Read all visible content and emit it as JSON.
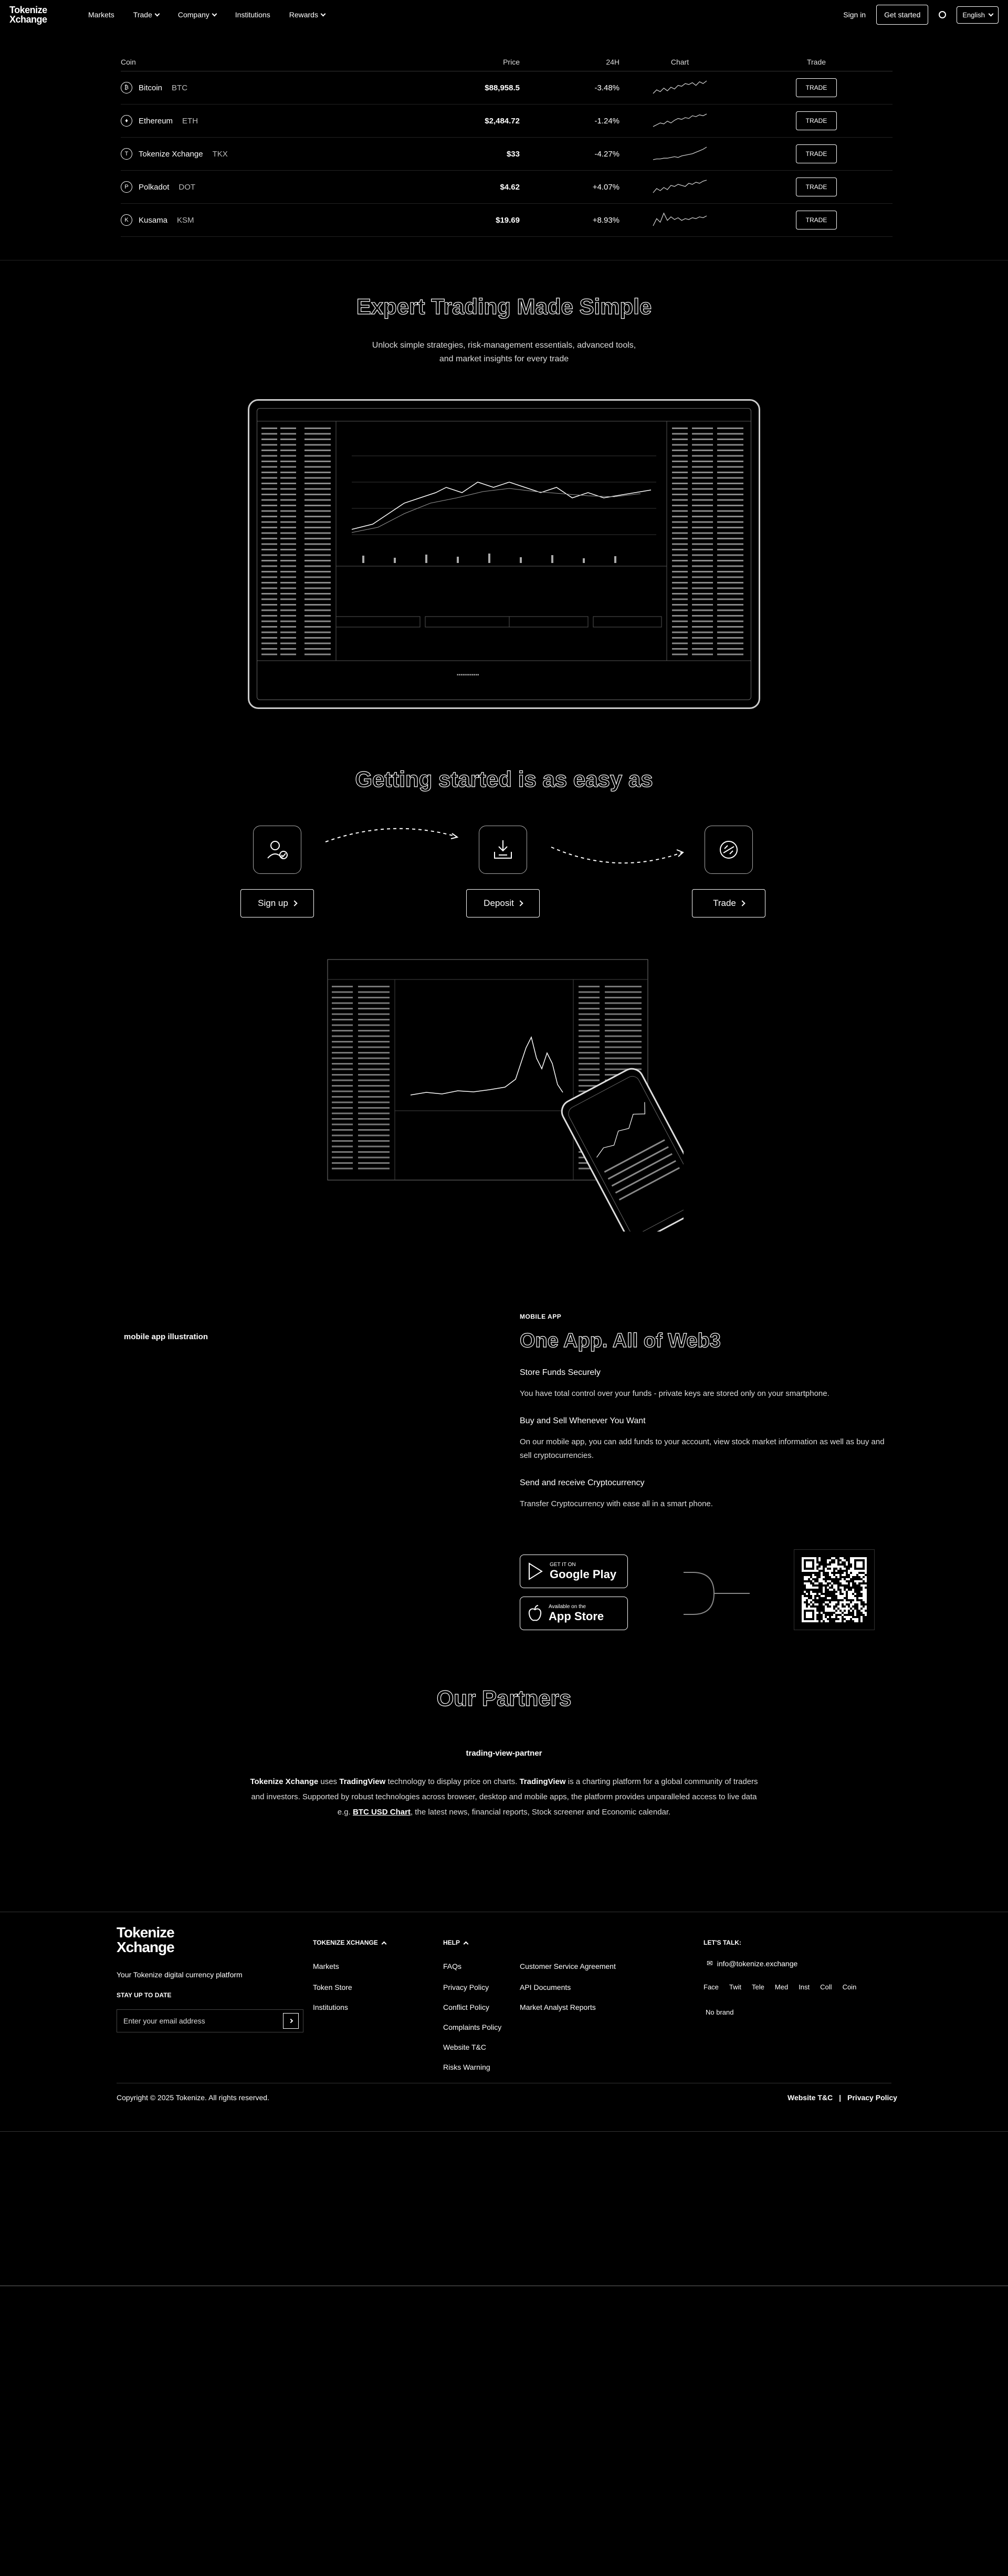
{
  "nav": {
    "logo_line1": "Tokenize",
    "logo_line2": "Xchange",
    "menu": [
      "Markets",
      "Trade",
      "Company",
      "Institutions",
      "Rewards"
    ],
    "sign_in": "Sign in",
    "get_started": "Get started",
    "language": "English"
  },
  "market": {
    "headers": [
      "Coin",
      "Price",
      "24H",
      "Chart",
      "Trade"
    ],
    "rows": [
      {
        "name": "Bitcoin",
        "symbol": "BTC",
        "icon": "₿",
        "price": "$88,958.5",
        "change": "-3.48%",
        "trade": "TRADE",
        "spark": [
          8,
          12,
          10,
          14,
          11,
          15,
          13,
          17,
          16,
          19,
          18,
          20,
          17,
          21,
          19,
          22
        ]
      },
      {
        "name": "Ethereum",
        "symbol": "ETH",
        "icon": "♦",
        "price": "$2,484.72",
        "change": "-1.24%",
        "trade": "TRADE",
        "spark": [
          9,
          11,
          13,
          12,
          15,
          13,
          16,
          18,
          17,
          19,
          18,
          21,
          20,
          22,
          21,
          23
        ]
      },
      {
        "name": "Tokenize Xchange",
        "symbol": "TKX",
        "icon": "T",
        "price": "$33",
        "change": "-4.27%",
        "trade": "TRADE",
        "spark": [
          5,
          6,
          6,
          7,
          7,
          8,
          9,
          8,
          10,
          11,
          12,
          13,
          15,
          17,
          19,
          22
        ]
      },
      {
        "name": "Polkadot",
        "symbol": "DOT",
        "icon": "P",
        "price": "$4.62",
        "change": "+4.07%",
        "trade": "TRADE",
        "spark": [
          10,
          14,
          12,
          15,
          13,
          17,
          16,
          18,
          17,
          16,
          19,
          18,
          20,
          19,
          21,
          22
        ]
      },
      {
        "name": "Kusama",
        "symbol": "KSM",
        "icon": "K",
        "price": "$19.69",
        "change": "+8.93%",
        "trade": "TRADE",
        "spark": [
          8,
          16,
          12,
          22,
          14,
          18,
          15,
          17,
          14,
          16,
          15,
          17,
          16,
          18,
          17,
          19
        ]
      }
    ]
  },
  "expert": {
    "title": "Expert Trading Made Simple",
    "subtitle_1": "Unlock simple strategies, risk-management essentials, advanced tools,",
    "subtitle_2": "and market insights for every trade"
  },
  "getting_started": {
    "title": "Getting started is as easy as",
    "steps": [
      "Sign up",
      "Deposit",
      "Trade"
    ]
  },
  "mobile": {
    "illustration_alt": "mobile app illustration",
    "eyebrow": "MOBILE APP",
    "title": "One App. All of Web3",
    "features": [
      {
        "h": "Store Funds Securely",
        "p": "You have total control over your funds - private keys are stored only on your smartphone."
      },
      {
        "h": "Buy and Sell Whenever You Want",
        "p": "On our mobile app, you can add funds to your account, view stock market information as well as buy and sell cryptocurrencies."
      },
      {
        "h": "Send and receive Cryptocurrency",
        "p": "Transfer Cryptocurrency with ease all in a smart phone."
      }
    ],
    "google_small": "GET IT ON",
    "google_big": "Google Play",
    "apple_small": "Available on the",
    "apple_big": "App Store"
  },
  "partners": {
    "title": "Our Partners",
    "partner_name": "trading-view-partner",
    "p_1": "Tokenize Xchange",
    "p_2": " uses ",
    "p_3": "TradingView",
    "p_4": " technology to display price on charts. ",
    "p_5": "TradingView",
    "p_6": " is a charting platform for a global community of traders and investors. Supported by robust technologies across browser, desktop and mobile apps, the platform provides unparalleled access to live data e.g. ",
    "p_7": "BTC USD Chart",
    "p_8": ", the latest news, financial reports, Stock screener and Economic calendar."
  },
  "footer": {
    "logo_line1": "Tokenize",
    "logo_line2": "Xchange",
    "tagline": "Your Tokenize digital currency platform",
    "signup_label": "STAY UP TO DATE",
    "email_placeholder": "Enter your email address",
    "col1_title": "TOKENIZE XCHANGE",
    "col1_links": [
      "Markets",
      "Token Store",
      "Institutions"
    ],
    "col2_title": "HELP",
    "col2_links": [
      "FAQs",
      "Privacy Policy",
      "Conflict Policy",
      "Complaints Policy",
      "Website T&C",
      "Risks Warning"
    ],
    "col3_links": [
      "Customer Service Agreement",
      "API Documents",
      "Market Analyst Reports"
    ],
    "talk_title": "LET'S TALK:",
    "email": "info@tokenize.exchange",
    "socials": [
      "Face",
      "Twit",
      "Tele",
      "Med",
      "Inst",
      "Coll",
      "Coin"
    ],
    "no_brand": "No brand",
    "copyright": "Copyright © 2025 Tokenize. All rights reserved.",
    "legal_1": "Website T&C",
    "legal_sep": "|",
    "legal_2": "Privacy Policy"
  }
}
